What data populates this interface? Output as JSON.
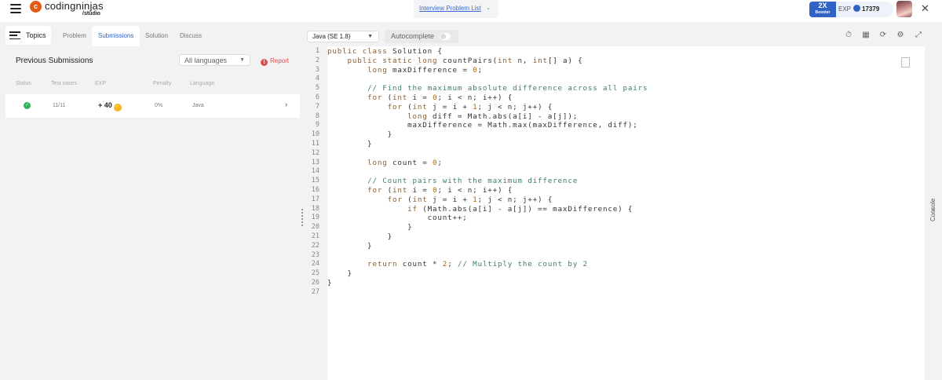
{
  "header": {
    "logo_mark": "c",
    "logo_name": "codingninjas",
    "logo_sub": "/studio",
    "problem_list_link": "Interview Problem List",
    "booster_top": "2X",
    "booster_bottom": "Booster",
    "exp_label": "EXP",
    "exp_value": "17379"
  },
  "left": {
    "topics_label": "Topics",
    "tabs": [
      "Problem",
      "Submissions",
      "Solution",
      "Discuss"
    ],
    "active_tab": "Submissions",
    "title": "Previous Submissions",
    "language_filter": "All languages",
    "report_label": "Report",
    "columns": [
      "Status",
      "Test cases",
      "EXP",
      "Penalty",
      "Language"
    ],
    "submissions": [
      {
        "status": "accepted",
        "test_cases": "11/11",
        "exp": "+ 40",
        "penalty": "0%",
        "language": "Java"
      }
    ]
  },
  "editor": {
    "language": "Java (SE 1.8)",
    "autocomplete_label": "Autocomplete",
    "autocomplete_on": false,
    "tools": [
      "timer-icon",
      "save-icon",
      "reset-icon",
      "settings-icon",
      "fullscreen-icon"
    ],
    "code_lines": [
      "public class Solution {",
      "    public static long countPairs(int n, int[] a) {",
      "        long maxDifference = 0;",
      "",
      "        // Find the maximum absolute difference across all pairs",
      "        for (int i = 0; i < n; i++) {",
      "            for (int j = i + 1; j < n; j++) {",
      "                long diff = Math.abs(a[i] - a[j]);",
      "                maxDifference = Math.max(maxDifference, diff);",
      "            }",
      "        }",
      "",
      "        long count = 0;",
      "",
      "        // Count pairs with the maximum difference",
      "        for (int i = 0; i < n; i++) {",
      "            for (int j = i + 1; j < n; j++) {",
      "                if (Math.abs(a[i] - a[j]) == maxDifference) {",
      "                    count++;",
      "                }",
      "            }",
      "        }",
      "",
      "        return count * 2; // Multiply the count by 2",
      "    }",
      "}",
      ""
    ]
  },
  "console_label": "Console",
  "colors": {
    "brand": "#e35a16",
    "accent": "#3162c4",
    "success": "#2fb35a",
    "danger": "#e34d4d"
  }
}
